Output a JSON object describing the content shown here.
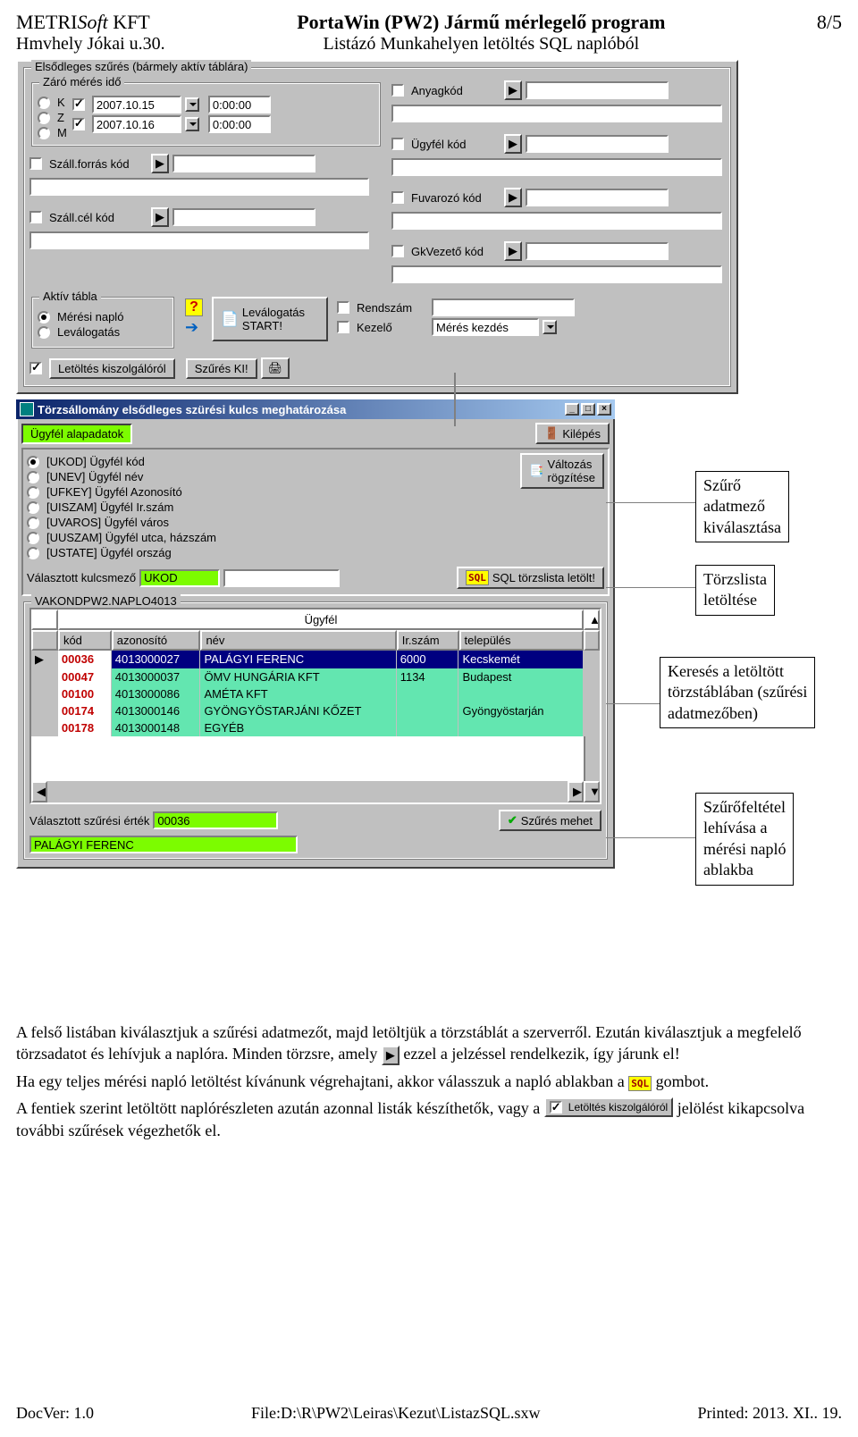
{
  "header": {
    "company_line1_a": "METRI",
    "company_line1_b": "Soft",
    "company_line1_c": " KFT",
    "company_line2": "Hmvhely Jókai u.30.",
    "title": "PortaWin (PW2) Jármű mérlegelő program",
    "subtitle": "Listázó Munkahelyen letöltés SQL naplóból",
    "page": "8/5"
  },
  "panel1": {
    "group_primary": "Elsődleges szűrés (bármely aktív táblára)",
    "group_time": "Záró mérés  idő",
    "radio_k": "K",
    "radio_z": "Z",
    "radio_m": "M",
    "date1": "2007.10.15",
    "time1": "0:00:00",
    "date2": "2007.10.16",
    "time2": "0:00:00",
    "lbl_szallforras": "Száll.forrás kód",
    "lbl_szallcel": "Száll.cél kód",
    "lbl_anyagkod": "Anyagkód",
    "lbl_ugyfelkod": "Ügyfél kód",
    "lbl_fuvarozo": "Fuvarozó kód",
    "lbl_gkvezeto": "GkVezető kód",
    "group_aktiv": "Aktív tábla",
    "rad_meresi": "Mérési napló",
    "rad_levalogatas": "Leválogatás",
    "btn_levalogatas": "Leválogatás\nSTART!",
    "lbl_rendszam": "Rendszám",
    "lbl_kezelo": "Kezelő",
    "combo_kezelo": "Mérés kezdés",
    "chk_letoltes": "Letöltés kiszolgálóról",
    "btn_szureski": "Szűrés KI!"
  },
  "dialog": {
    "title": "Törzsállomány elsődleges szürési kulcs meghatározása",
    "tab_ugyfel": "Ügyfél alapadatok",
    "btn_kilepes": "Kilépés",
    "btn_valtozas": "Változás\nrögzítése",
    "radios": [
      "[UKOD] Ügyfél kód",
      "[UNEV] Ügyfél név",
      "[UFKEY] Ügyfél Azonosító",
      "[UISZAM] Ügyfél Ir.szám",
      "[UVAROS] Ügyfél város",
      "[UUSZAM] Ügyfél utca, házszám",
      "[USTATE] Ügyfél ország"
    ],
    "lbl_valasztott_kulcs": "Választott kulcsmező",
    "val_valasztott_kulcs": "UKOD",
    "btn_sql": "SQL törzslista letölt!",
    "group_db": "VAKONDPW2.NAPLO4013",
    "head_ugyfel": "Ügyfél",
    "cols": [
      "kód",
      "azonosító",
      "név",
      "Ir.szám",
      "település"
    ],
    "rows": [
      {
        "kod": "00036",
        "az": "4013000027",
        "nev": "PALÁGYI FERENC",
        "ir": "6000",
        "tel": "Kecskemét",
        "sel": "navy"
      },
      {
        "kod": "00047",
        "az": "4013000037",
        "nev": "ÖMV HUNGÁRIA  KFT",
        "ir": "1134",
        "tel": "Budapest",
        "sel": "teal"
      },
      {
        "kod": "00100",
        "az": "4013000086",
        "nev": "AMÉTA KFT",
        "ir": "",
        "tel": "",
        "sel": "teal"
      },
      {
        "kod": "00174",
        "az": "4013000146",
        "nev": "GYÖNGYÖSTARJÁNI KŐZET",
        "ir": "",
        "tel": "Gyöngyöstarján",
        "sel": "teal"
      },
      {
        "kod": "00178",
        "az": "4013000148",
        "nev": "EGYÉB",
        "ir": "",
        "tel": "",
        "sel": "teal"
      }
    ],
    "lbl_valasztott_ertek": "Választott szűrési érték",
    "val_valasztott_ertek": "00036",
    "btn_szures_mehet": "Szűrés mehet",
    "val_selected_name": "PALÁGYI FERENC"
  },
  "callouts": {
    "c1": "Szűrő\nadatmező\nkiválasztása",
    "c2": "Törzslista\nletöltése",
    "c3": "Keresés a letöltött\ntörzstáblában (szűrési\nadatmezőben)",
    "c4": "Szűrőfeltétel\nlehívása a\nmérési napló\nablakba"
  },
  "body_text": {
    "p1a": "A felső listában kiválasztjuk a szűrési adatmezőt, majd letöltjük a törzstáblát a szerverről. Ezután kiválasztjuk a megfelelő törzsadatot és lehívjuk a naplóra. Minden törzsre, amely ",
    "p1b": " ezzel a jelzéssel rendelkezik, így járunk el!",
    "p2a": "Ha egy teljes mérési napló letöltést kívánunk végrehajtani, akkor válasszuk a napló ablakban a ",
    "p2b": " gombot.",
    "p3a": "A fentiek szerint letöltött naplórészleten azután azonnal listák készíthetők, vagy a ",
    "p3b_img": "Letöltés kiszolgálóról",
    "p3c": " jelölést kikapcsolva további szűrések végezhetők el."
  },
  "footer": {
    "left": "DocVer: 1.0",
    "center": "File:D:\\R\\PW2\\Leiras\\Kezut\\ListazSQL.sxw",
    "right": "Printed: 2013. XI.. 19."
  }
}
